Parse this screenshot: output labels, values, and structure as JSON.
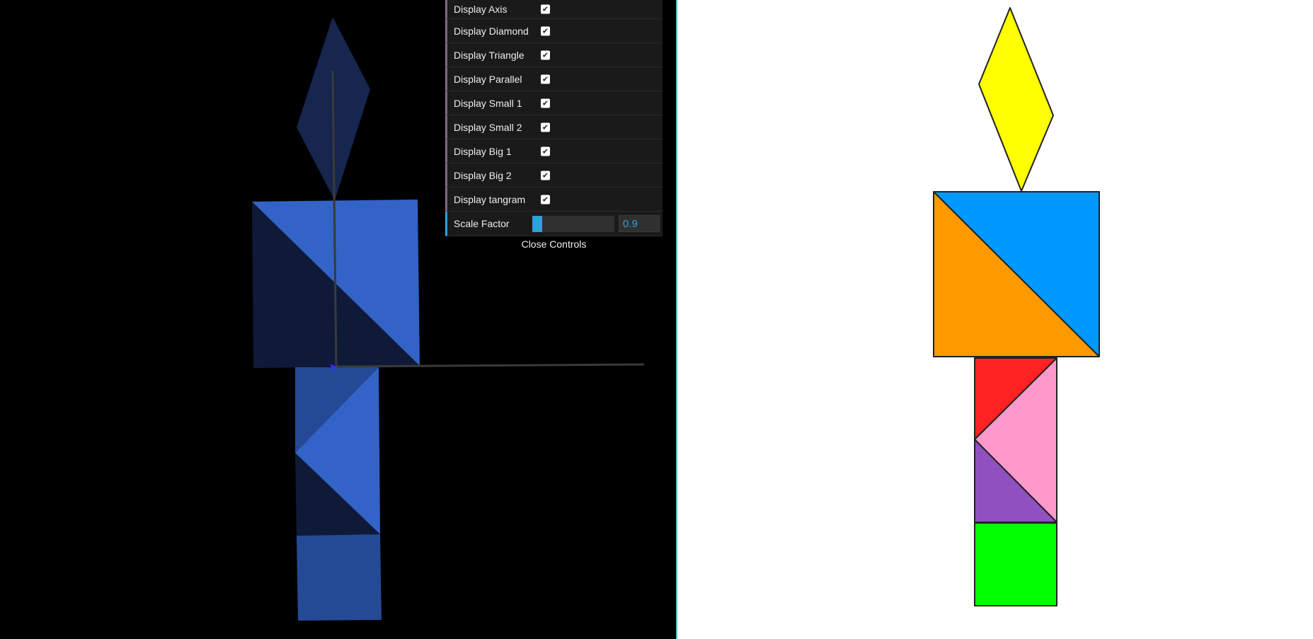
{
  "gui": {
    "checkboxes": [
      {
        "label": "Display Axis",
        "checked": true
      },
      {
        "label": "Display Diamond",
        "checked": true
      },
      {
        "label": "Display Triangle",
        "checked": true
      },
      {
        "label": "Display Parallel",
        "checked": true
      },
      {
        "label": "Display Small 1",
        "checked": true
      },
      {
        "label": "Display Small 2",
        "checked": true
      },
      {
        "label": "Display Big 1",
        "checked": true
      },
      {
        "label": "Display Big 2",
        "checked": true
      },
      {
        "label": "Display tangram",
        "checked": true
      }
    ],
    "check_glyph": "✔",
    "scale": {
      "label": "Scale Factor",
      "value": "0.9",
      "fraction": 0.12
    },
    "close_label": "Close Controls"
  },
  "colors": {
    "gui_bg": "#1a1a1a",
    "slider_accent": "#2fa1d6",
    "checkbox_border": "#806787",
    "divider": "#57b7c7",
    "diamond": "#ffff00",
    "big1": "#0099ff",
    "big2": "#ff9900",
    "small1": "#ff2222",
    "parallel": "#ff99cc",
    "triangle": "#9150bf",
    "square": "#00ff00",
    "scene_blue": "#3366cc",
    "scene_dark": "#0f1a38"
  }
}
